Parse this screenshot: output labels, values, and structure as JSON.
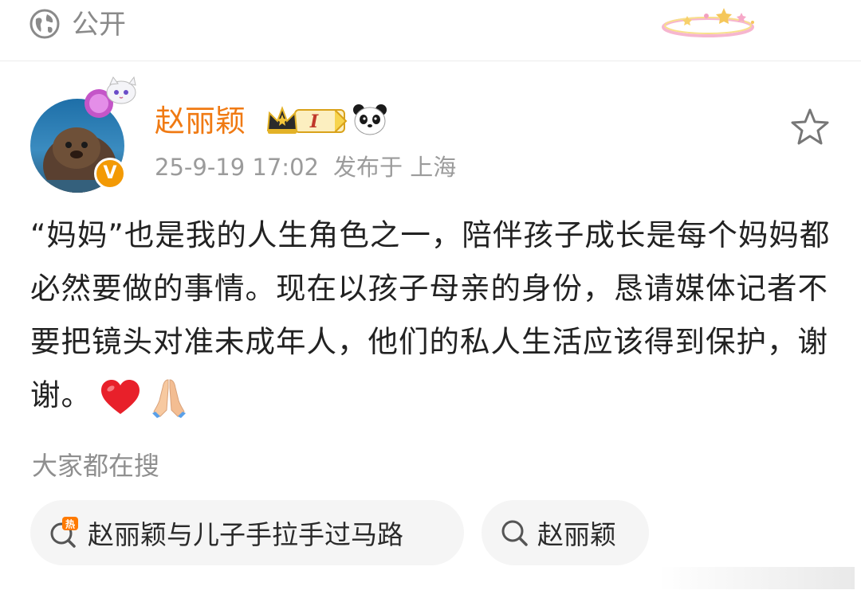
{
  "header": {
    "privacy_icon": "globe-icon",
    "privacy_label": "公开"
  },
  "post": {
    "author": {
      "name": "赵丽颖",
      "verified_badge": "V",
      "avatar": "avatar-image",
      "level_badge": "I",
      "badge_icons": [
        "crown-icon",
        "panda-icon"
      ]
    },
    "timestamp": "25-9-19 17:02",
    "location": "发布于 上海",
    "body": "“妈妈”也是我的人生角色之一，陪伴孩子成长是每个妈妈都必然要做的事情。现在以孩子母亲的身份，恳请媒体记者不要把镜头对准未成年人，他们的私人生活应该得到保护，谢谢。",
    "emojis": [
      "heart-emoji",
      "pray-emoji"
    ],
    "favorite_icon": "star-icon"
  },
  "related": {
    "heading": "大家都在搜",
    "chips": [
      {
        "label": "赵丽颖与儿子手拉手过马路",
        "icon": "hot-search-icon"
      },
      {
        "label": "赵丽颖",
        "icon": "search-icon"
      }
    ]
  },
  "colors": {
    "username": "#f07a13",
    "verified": "#f39a05",
    "muted": "#9b9b9b"
  }
}
